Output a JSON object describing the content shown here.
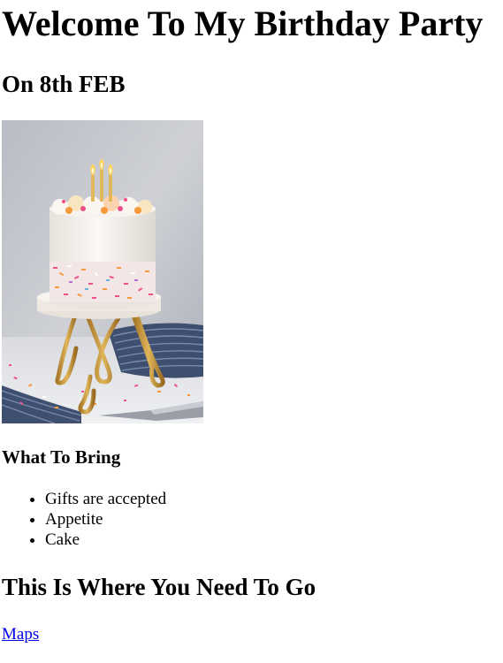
{
  "header": {
    "title": "Welcome To My Birthday Party",
    "date": "On 8th FEB"
  },
  "image": {
    "subject": "birthday-cake-photo",
    "colors": {
      "background": "#c4c6cc",
      "frosting": "#f4f0ea",
      "stand_gold": "#c99a3a",
      "cloth": "#4a5a7a",
      "sprinkle_pink": "#f0508a",
      "sprinkle_orange": "#f59a3a",
      "flame": "#ffd45a"
    }
  },
  "bring": {
    "heading": "What To Bring",
    "items": [
      "Gifts are accepted",
      "Appetite",
      "Cake"
    ]
  },
  "directions": {
    "heading": "This Is Where You Need To Go",
    "link_label": "Maps"
  }
}
